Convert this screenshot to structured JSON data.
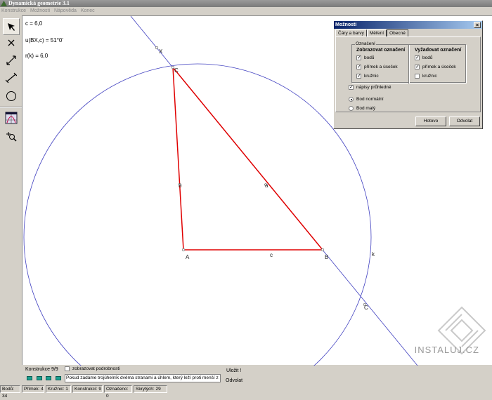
{
  "window": {
    "title": "Dynamická geometrie 3.1"
  },
  "menu": [
    "Konstrukce",
    "Možnosti",
    "Nápověda",
    "Konec"
  ],
  "tools": [
    "select-arrow",
    "point",
    "line",
    "segment",
    "circle",
    "graph",
    "zoom"
  ],
  "measurements": [
    "c =  6,0",
    "u(BX,c) = 51°0'",
    "r(k) =  6,0"
  ],
  "geometry_labels": {
    "A": "A",
    "B": "B",
    "C": "C",
    "C2": "C",
    "X": "X",
    "a": "a",
    "b": "b",
    "c": "c",
    "k": "k"
  },
  "colors": {
    "triangle": "#e00000",
    "lines": "#4040c0",
    "title_bar": "#0a246a"
  },
  "dialog": {
    "title": "Možnosti",
    "close": "×",
    "tabs": [
      "Čáry a barvy",
      "Měření",
      "Obecné"
    ],
    "active_tab": "Obecné",
    "group_label": "Označení",
    "show_header": "Zobrazovat označení",
    "require_header": "Vyžadovat označení",
    "show_items": [
      {
        "label": "bodů",
        "checked": true
      },
      {
        "label": "přímek a úseček",
        "checked": true
      },
      {
        "label": "kružnic",
        "checked": true
      }
    ],
    "require_items": [
      {
        "label": "bodů",
        "checked": true
      },
      {
        "label": "přímek a úseček",
        "checked": true
      },
      {
        "label": "kružnic",
        "checked": false
      }
    ],
    "transparent": {
      "label": "nápisy průhledné",
      "checked": true
    },
    "point_options": [
      {
        "label": "Bod normální",
        "selected": true
      },
      {
        "label": "Bod malý",
        "selected": false
      }
    ],
    "ok": "Hotovo",
    "cancel": "Odvolat"
  },
  "bottom": {
    "construction": "Konstrukce 9/9",
    "details_label": "zobrazovat podrobnosti",
    "description": "Pokud zadáme trojúhelník dvěma stranami a úhlem, který leží proti menší z nich, jsou",
    "save": "Uložit !",
    "cancel": "Odvolat"
  },
  "status": [
    "Bodů: 34",
    "Přímek: 4",
    "Kružnic: 1",
    "Konstrukcí: 9",
    "Označeno: 0",
    "Skrytých: 29"
  ],
  "watermark": "INSTALUJ.CZ"
}
